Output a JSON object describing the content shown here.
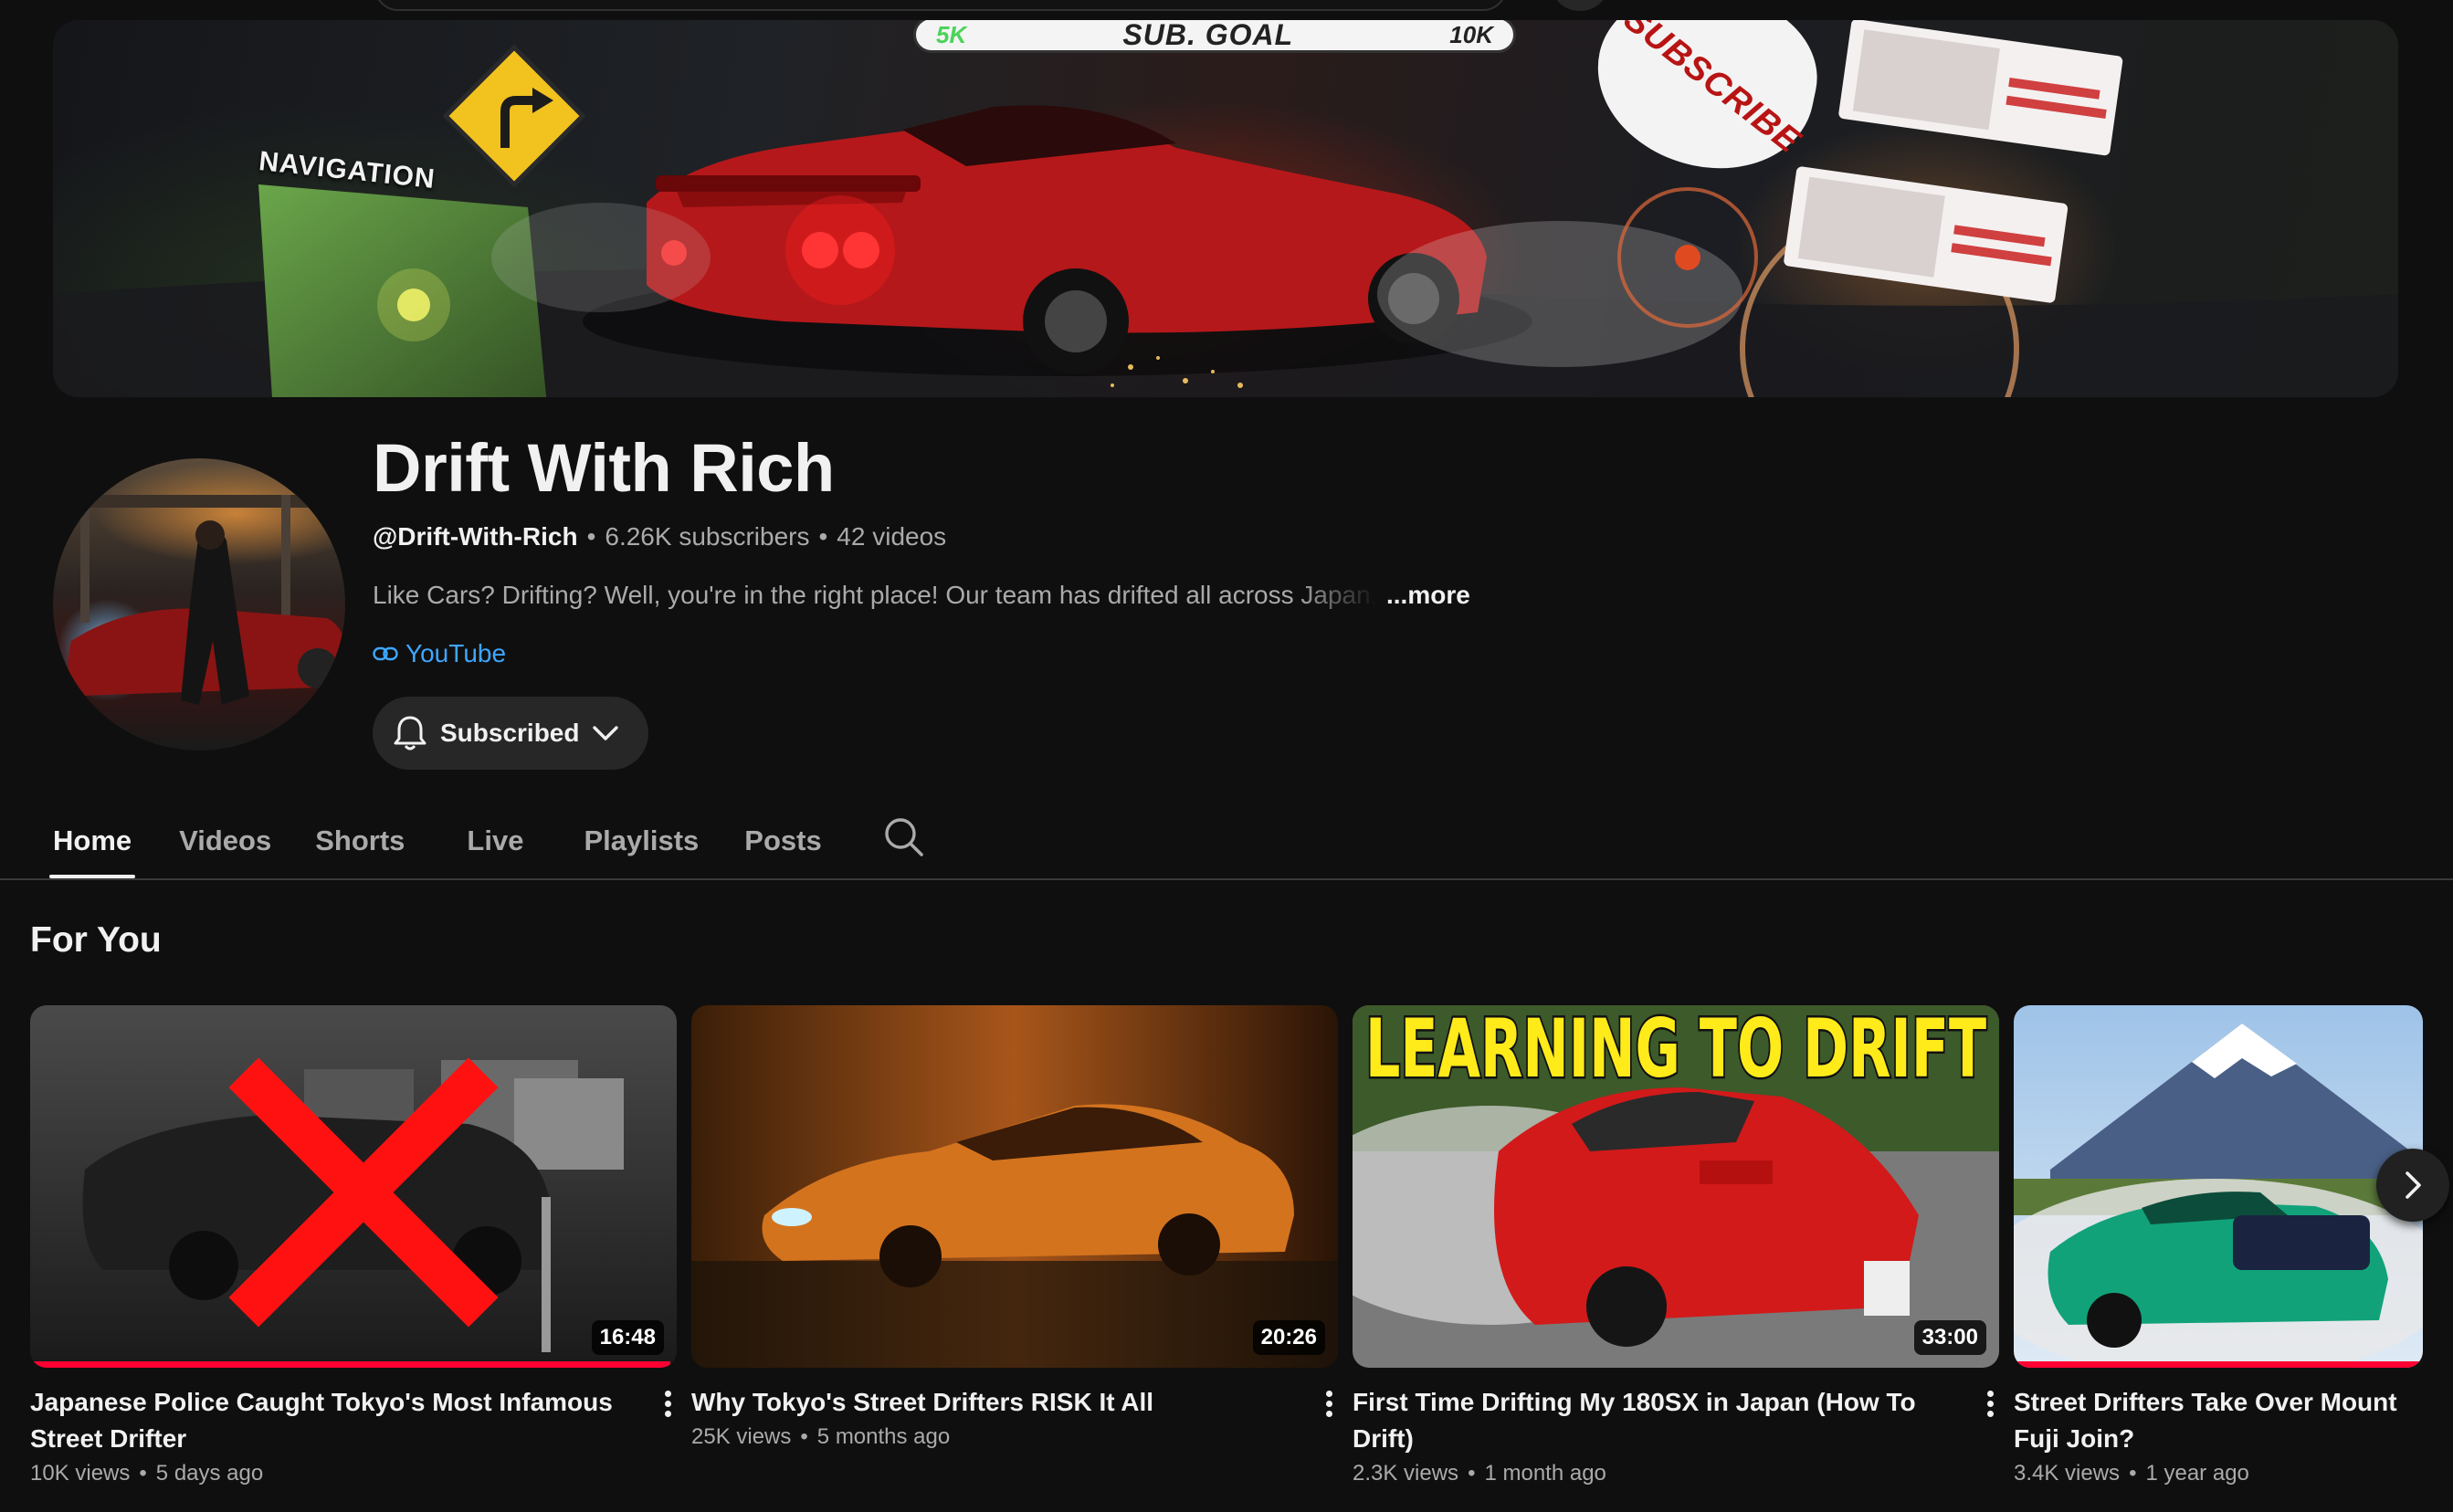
{
  "banner": {
    "goal_start": "5K",
    "goal_label": "SUB. GOAL",
    "goal_end": "10K",
    "nav_sign": "NAVIGATION",
    "subscribe_text": "SUBSCRIBE"
  },
  "channel": {
    "name": "Drift With Rich",
    "handle": "@Drift-With-Rich",
    "subscribers": "6.26K subscribers",
    "videos": "42 videos",
    "description": "Like Cars? Drifting? Well, you're in the right place! Our team has drifted all across Japan, t",
    "more_label": "...more",
    "link_label": "YouTube",
    "subscribe_label": "Subscribed"
  },
  "tabs": [
    {
      "label": "Home",
      "active": true
    },
    {
      "label": "Videos"
    },
    {
      "label": "Shorts"
    },
    {
      "label": "Live"
    },
    {
      "label": "Playlists"
    },
    {
      "label": "Posts"
    }
  ],
  "section": {
    "title": "For You"
  },
  "videos": [
    {
      "title": "Japanese Police Caught Tokyo's Most Infamous Street Drifter",
      "views": "10K views",
      "age": "5 days ago",
      "duration": "16:48",
      "watched": 0.99
    },
    {
      "title": "Why Tokyo's Street Drifters RISK It All",
      "views": "25K views",
      "age": "5 months ago",
      "duration": "20:26",
      "watched": 0
    },
    {
      "title": "First Time Drifting My 180SX in Japan (How To Drift)",
      "views": "2.3K views",
      "age": "1 month ago",
      "duration": "33:00",
      "watched": 0,
      "thumb_text": "LEARNING TO DRIFT"
    },
    {
      "title": "Street Drifters Take Over Mount Fuji Join?",
      "views": "3.4K views",
      "age": "1 year ago",
      "duration": "",
      "watched": 1
    }
  ],
  "colors": {
    "background": "#0f0f0f",
    "link": "#3ea6ff",
    "progress": "#ff0033"
  }
}
